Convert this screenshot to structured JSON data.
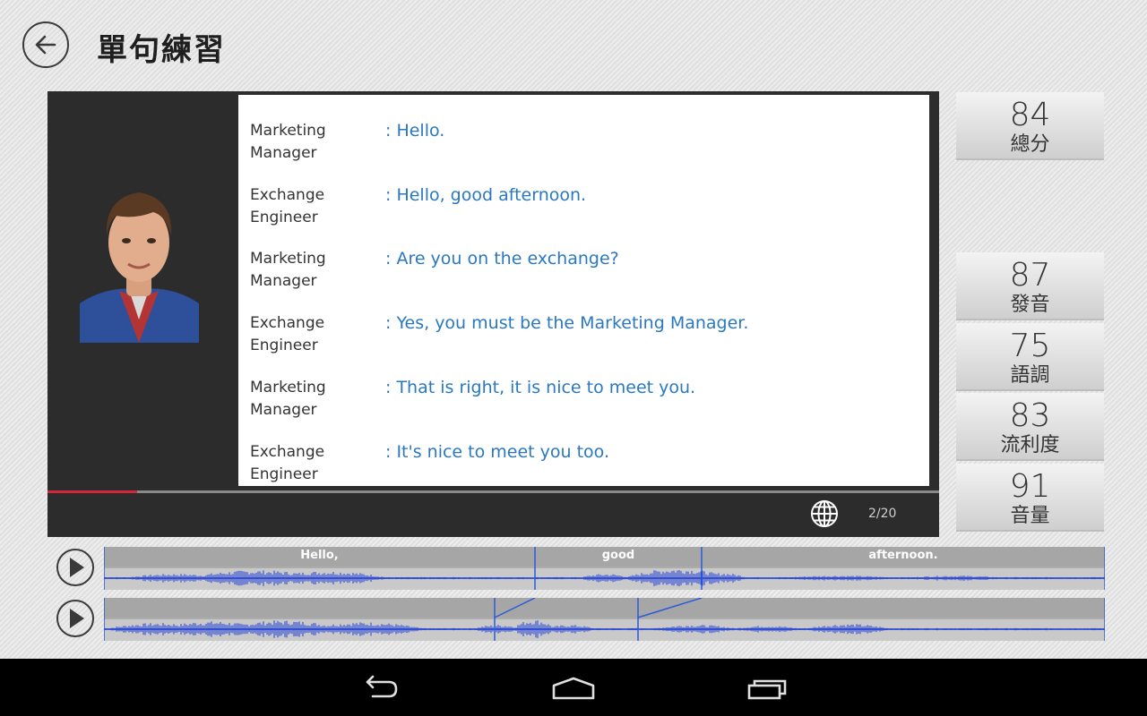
{
  "header": {
    "title": "單句練習"
  },
  "dialog": {
    "lines": [
      {
        "speaker": [
          "Marketing",
          "Manager"
        ],
        "text": ": Hello."
      },
      {
        "speaker": [
          "Exchange",
          "Engineer"
        ],
        "text": ": Hello, good afternoon."
      },
      {
        "speaker": [
          "Marketing",
          "Manager"
        ],
        "text": ": Are you on the exchange?"
      },
      {
        "speaker": [
          "Exchange",
          "Engineer"
        ],
        "text": ": Yes, you must be the Marketing Manager."
      },
      {
        "speaker": [
          "Marketing",
          "Manager"
        ],
        "text": ": That is right, it is nice to meet you."
      },
      {
        "speaker": [
          "Exchange",
          "Engineer"
        ],
        "text": ": It's nice to meet you too."
      }
    ]
  },
  "player": {
    "progress_fraction": 0.1,
    "pager": "2/20"
  },
  "scores": [
    {
      "value": "84",
      "label": "總分"
    },
    {
      "value": "87",
      "label": "發音"
    },
    {
      "value": "75",
      "label": "語調"
    },
    {
      "value": "83",
      "label": "流利度"
    },
    {
      "value": "91",
      "label": "音量"
    }
  ],
  "waveform": {
    "words": [
      "Hello,",
      "good",
      "afternoon."
    ]
  },
  "colors": {
    "accent": "#d3283a",
    "text_blue": "#2a78c0",
    "wave": "#1e3fd6"
  },
  "icons": {
    "back": "back-arrow-icon",
    "globe": "globe-icon",
    "play": "play-icon",
    "nav_back": "nav-back-icon",
    "nav_home": "nav-home-icon",
    "nav_recent": "nav-recent-apps-icon"
  }
}
